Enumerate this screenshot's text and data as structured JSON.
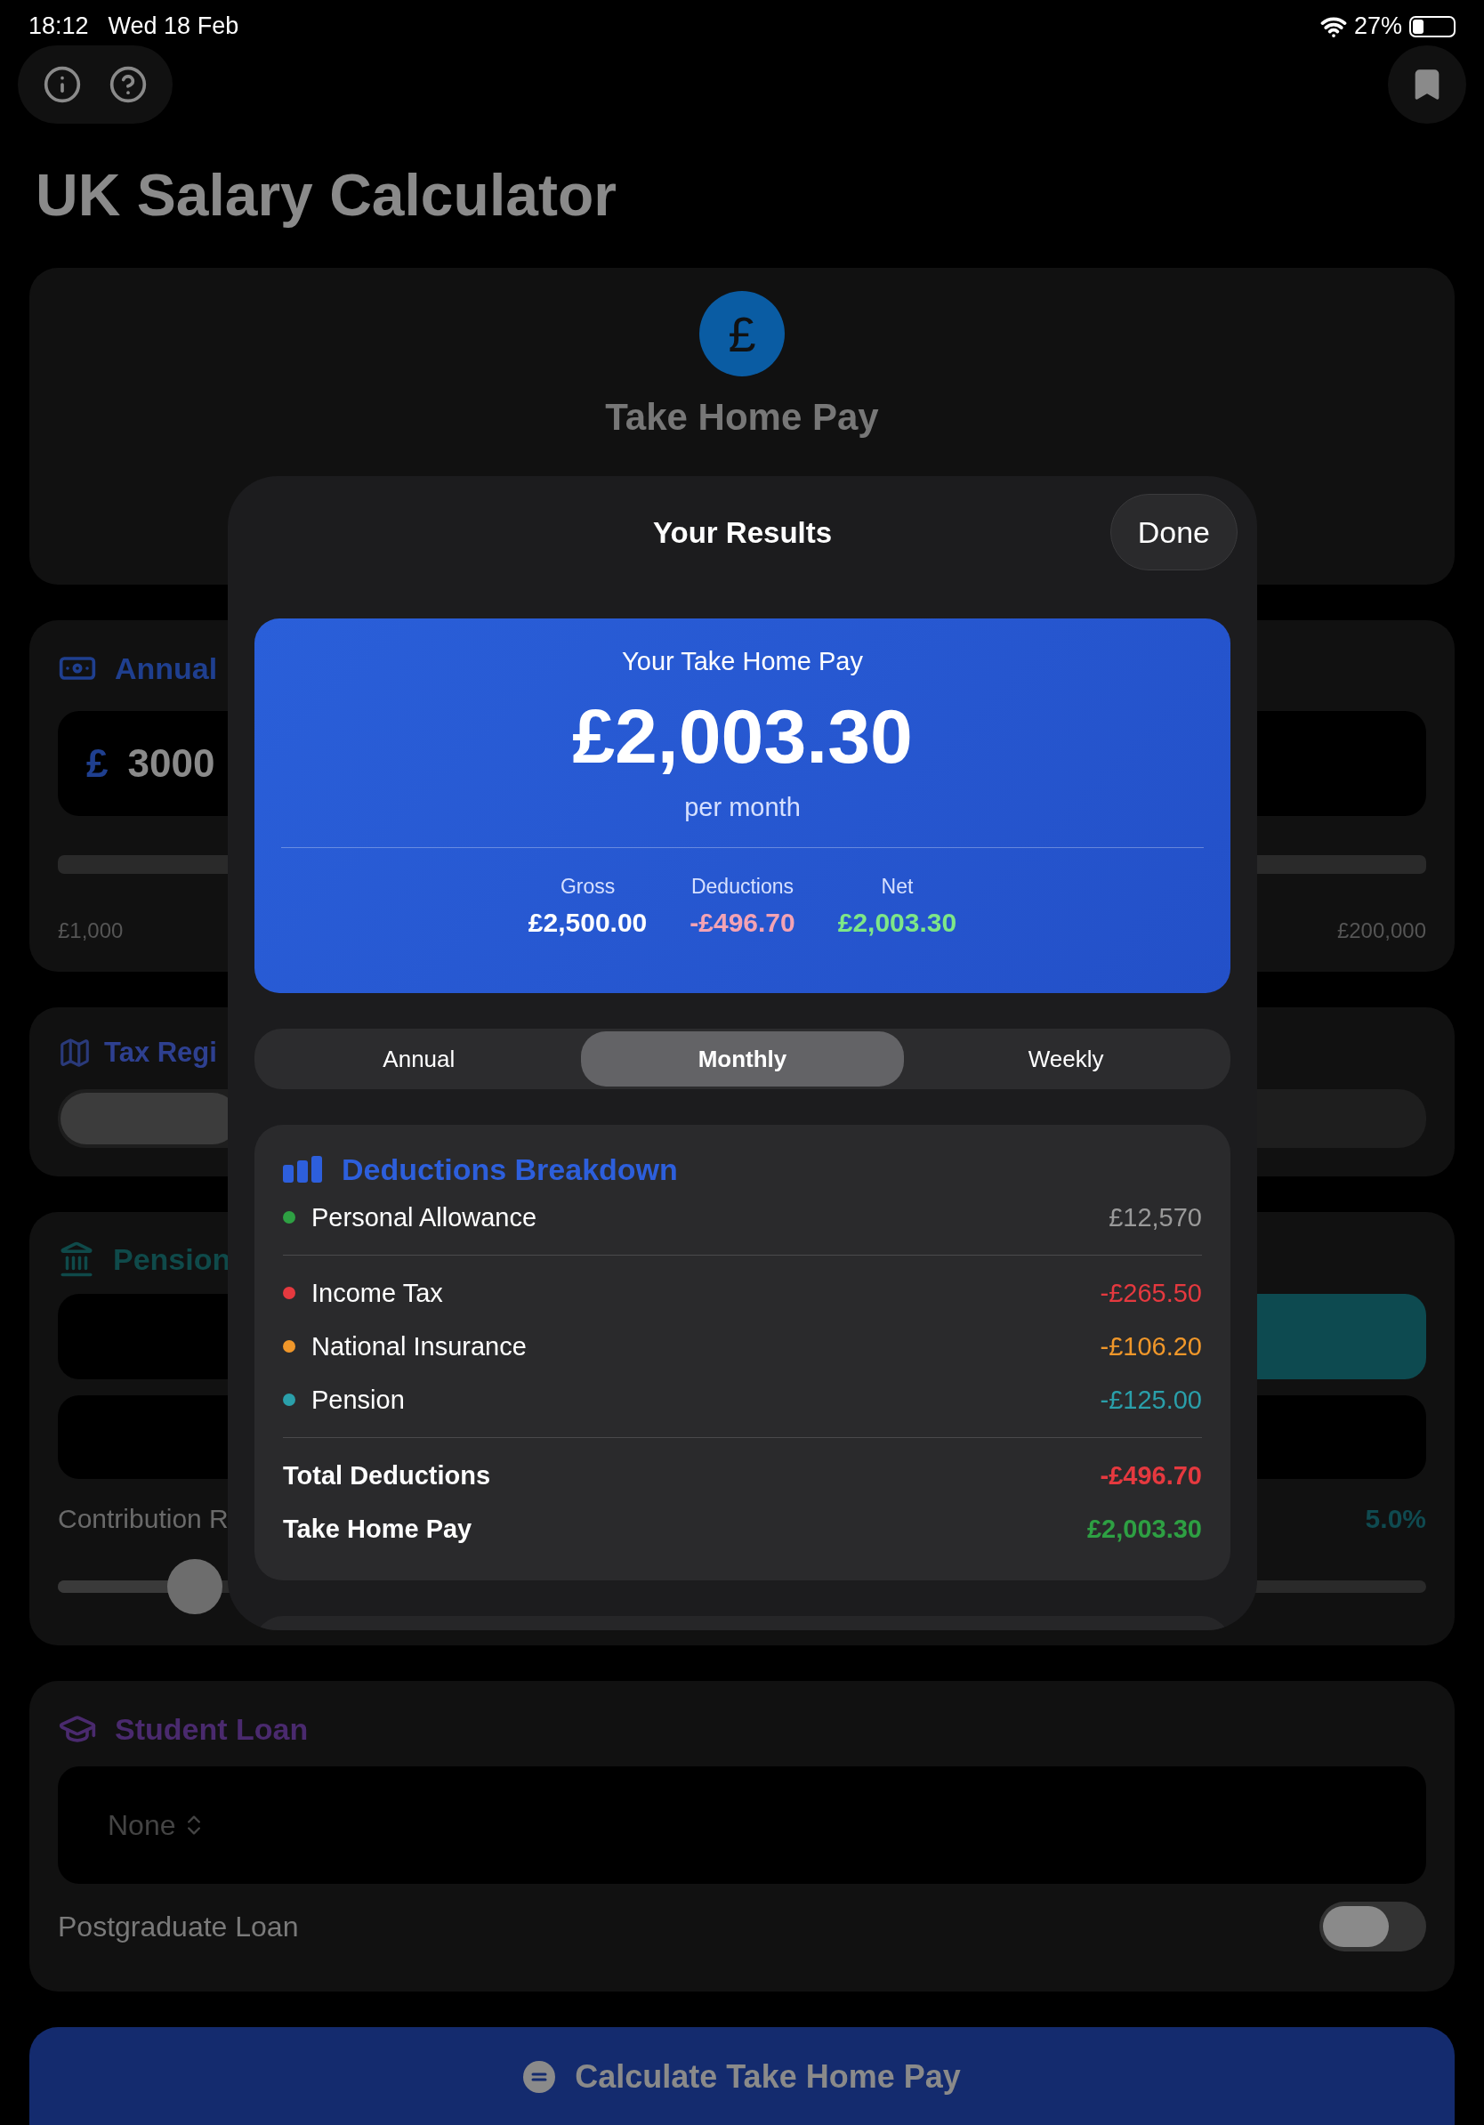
{
  "status_bar": {
    "time": "18:12",
    "date": "Wed 18 Feb",
    "battery": "27%"
  },
  "title": "UK Salary Calculator",
  "summary_card": {
    "symbol": "£",
    "title": "Take Home Pay"
  },
  "annual_card": {
    "title": "Annual",
    "currency": "£",
    "value": "3000",
    "min_label": "£1,000",
    "max_label": "£200,000"
  },
  "tax_card": {
    "title": "Tax Regi"
  },
  "pension_card": {
    "title": "Pension",
    "contribution_label": "Contribution R",
    "contribution_value": "5.0%",
    "slider": {
      "level": 0.1
    }
  },
  "student_loan_card": {
    "title": "Student Loan",
    "plan": "None",
    "postgraduate": {
      "label": "Postgraduate Loan",
      "on": false
    }
  },
  "calculate_button": {
    "label": "Calculate Take Home Pay"
  },
  "results_sheet": {
    "title": "Your Results",
    "done": "Done",
    "hero": {
      "label": "Your Take Home Pay",
      "amount": "£2,003.30",
      "period": "per month",
      "stats": [
        {
          "label": "Gross",
          "value": "£2,500.00",
          "color": "#ffffff"
        },
        {
          "label": "Deductions",
          "value": "-£496.70",
          "color": "#f4a3b4"
        },
        {
          "label": "Net",
          "value": "£2,003.30",
          "color": "#7ee787"
        }
      ]
    },
    "periods": [
      {
        "label": "Annual",
        "selected": false
      },
      {
        "label": "Monthly",
        "selected": true
      },
      {
        "label": "Weekly",
        "selected": false
      }
    ],
    "breakdown": {
      "title": "Deductions Breakdown",
      "sections": [
        [
          {
            "kind": "allowance",
            "label": "Personal Allowance",
            "value": "£12,570",
            "color": "#2ea043"
          }
        ],
        [
          {
            "kind": "deduction",
            "label": "Income Tax",
            "value": "-£265.50",
            "color": "#e5393f"
          },
          {
            "kind": "deduction",
            "label": "National Insurance",
            "value": "-£106.20",
            "color": "#f0972a"
          },
          {
            "kind": "deduction",
            "label": "Pension",
            "value": "-£125.00",
            "color": "#2a9faa"
          }
        ]
      ],
      "totals": [
        {
          "label": "Total Deductions",
          "value": "-£496.70",
          "color": "#e5393f"
        },
        {
          "label": "Take Home Pay",
          "value": "£2,003.30",
          "color": "#2ea043"
        }
      ]
    }
  }
}
